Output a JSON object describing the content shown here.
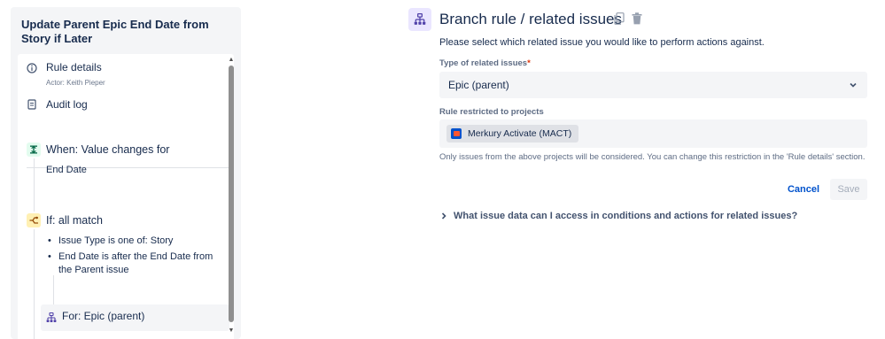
{
  "sidebar": {
    "rule_title": "Update Parent Epic End Date from Story if Later",
    "rule_details_label": "Rule details",
    "rule_details_sub": "Actor: Keith Pieper",
    "audit_log_label": "Audit log",
    "trigger_label": "When: Value changes for",
    "trigger_value": "End Date",
    "condition_label": "If: all match",
    "condition_items": [
      "Issue Type is one of: Story",
      "End Date is after the End Date from",
      "the Parent issue"
    ],
    "branch_label": "For: Epic (parent)"
  },
  "main": {
    "title": "Branch rule / related issues",
    "description": "Please select which related issue you would like to perform actions against.",
    "type_label": "Type of related issues",
    "type_required": "*",
    "type_value": "Epic (parent)",
    "projects_label": "Rule restricted to projects",
    "project_tag": "Merkury Activate (MACT)",
    "helper_text": "Only issues from the above projects will be considered. You can change this restriction in the 'Rule details' section.",
    "cancel_label": "Cancel",
    "save_label": "Save",
    "expander_label": "What issue data can I access in conditions and actions for related issues?"
  },
  "colors": {
    "accent": "#0052cc",
    "branch_purple": "#5243aa",
    "trigger_green": "#006644",
    "condition_yellow": "#fff0b3"
  },
  "icons": [
    "info-icon",
    "audit-log-icon",
    "trigger-icon",
    "condition-icon",
    "branch-icon",
    "copy-icon",
    "trash-icon",
    "chevron-down-icon",
    "chevron-right-icon",
    "project-avatar-icon"
  ]
}
